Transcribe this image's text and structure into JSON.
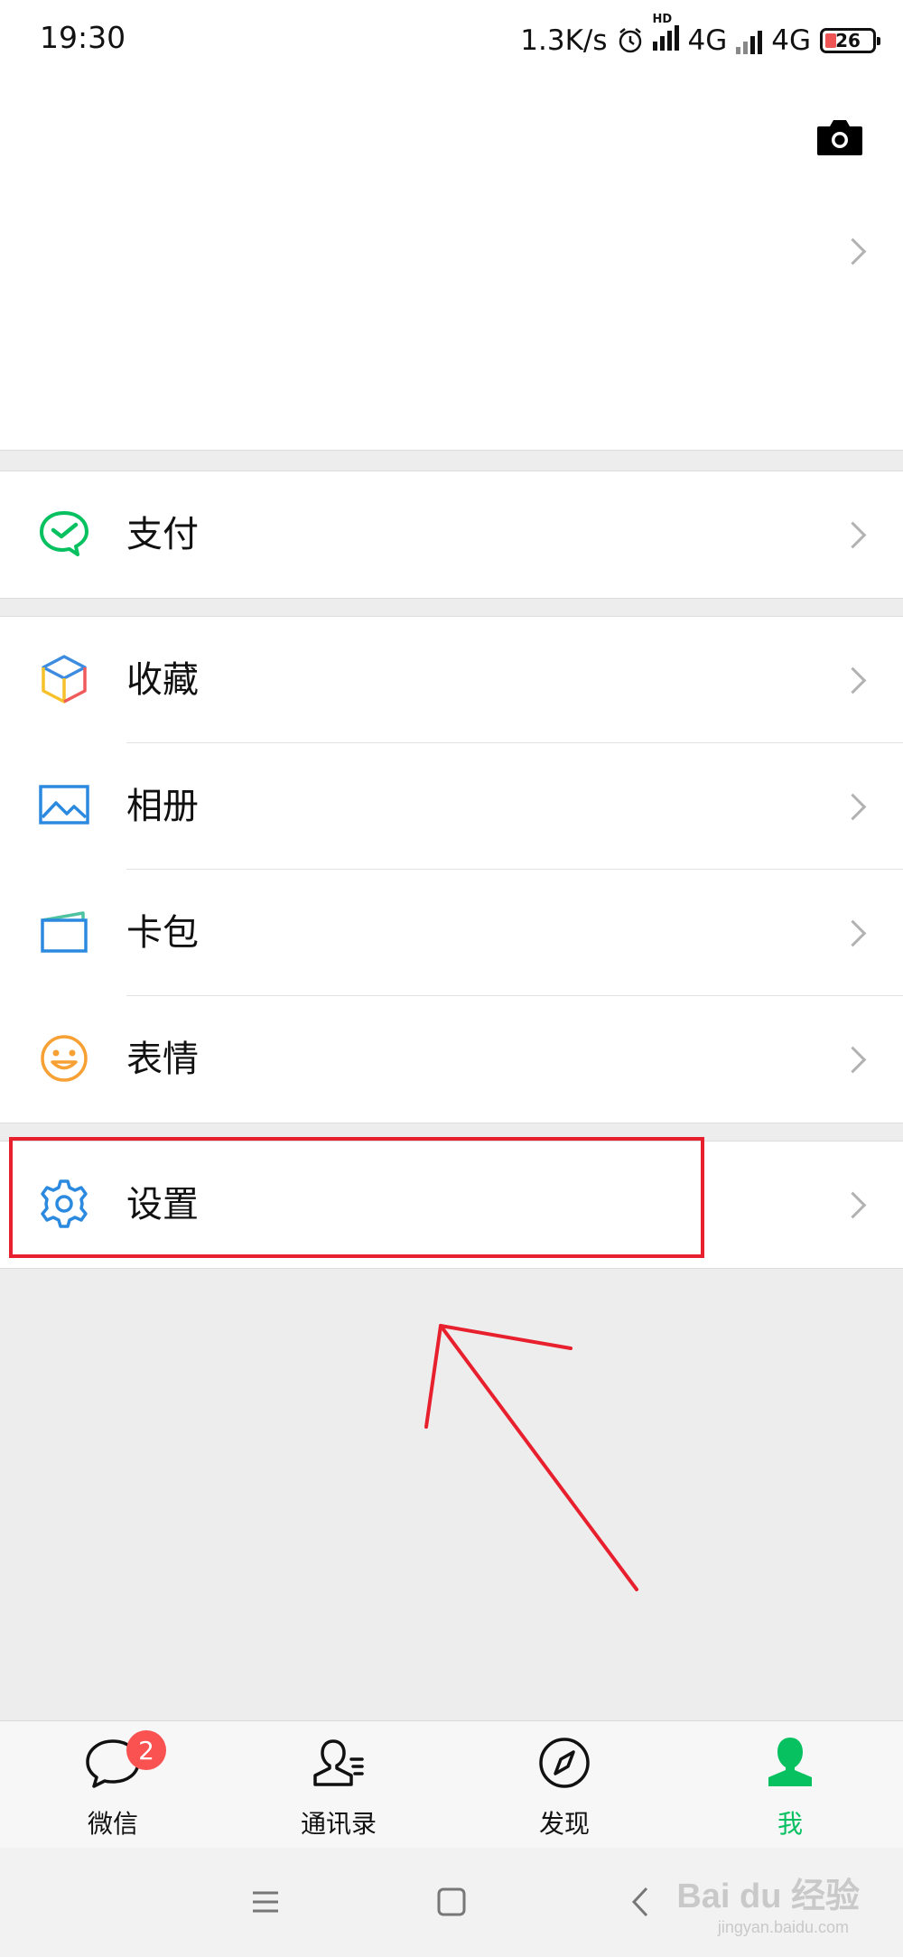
{
  "status_bar": {
    "time": "19:30",
    "speed": "1.3K/s",
    "hd": "HD",
    "network_1": "4G",
    "network_2": "4G",
    "battery": "26"
  },
  "header": {
    "camera_icon": "camera-icon"
  },
  "groups": [
    {
      "items": [
        {
          "label": "支付",
          "icon": "pay-icon",
          "color": "#07c160"
        }
      ]
    },
    {
      "items": [
        {
          "label": "收藏",
          "icon": "favorites-cube-icon",
          "color": "#3d8ce0"
        },
        {
          "label": "相册",
          "icon": "album-icon",
          "color": "#2b8ae0"
        },
        {
          "label": "卡包",
          "icon": "card-wallet-icon",
          "color": "#2b8ae0"
        },
        {
          "label": "表情",
          "icon": "emoji-icon",
          "color": "#f7a033"
        }
      ]
    },
    {
      "items": [
        {
          "label": "设置",
          "icon": "settings-gear-icon",
          "color": "#2b8ae0"
        }
      ]
    }
  ],
  "tabbar": {
    "tabs": [
      {
        "label": "微信",
        "icon": "chat-bubble-icon",
        "badge": "2"
      },
      {
        "label": "通讯录",
        "icon": "contacts-icon"
      },
      {
        "label": "发现",
        "icon": "compass-icon"
      },
      {
        "label": "我",
        "icon": "me-person-icon",
        "active": true
      }
    ],
    "active_color": "#07c160"
  },
  "annotation": {
    "color": "#e8202e"
  },
  "watermark": {
    "text": "Bai du 经验",
    "sub": "jingyan.baidu.com"
  }
}
